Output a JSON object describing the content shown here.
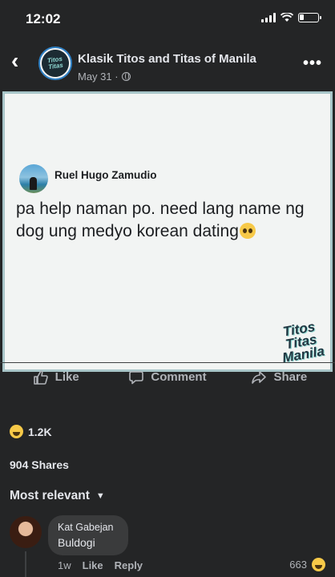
{
  "status_bar": {
    "time": "12:02",
    "battery_level": 0.25
  },
  "post": {
    "page_name": "Klasik Titos and Titas of Manila",
    "date": "May 31 ·",
    "page_logo_text": "Titos Titas",
    "image": {
      "author": "Ruel Hugo Zamudio",
      "text": "pa help naman po. need lang name ng dog ung medyo korean dating",
      "watermark": "Titos Titas Manila"
    }
  },
  "actions": {
    "like": "Like",
    "comment": "Comment",
    "share": "Share"
  },
  "stats": {
    "reactions_count": "1.2K",
    "shares": "904 Shares"
  },
  "comments_filter": "Most relevant",
  "comment": {
    "author": "Kat Gabejan",
    "text": "Buldogi",
    "time": "1w",
    "like": "Like",
    "reply": "Reply",
    "reaction_count": "663"
  },
  "colors": {
    "background": "#242526",
    "bubble": "#3a3b3c",
    "text_secondary": "#b0b3b8",
    "reaction": "#f7c948"
  },
  "icons": [
    "back-icon",
    "more-icon",
    "globe-icon",
    "like-icon",
    "comment-icon",
    "share-icon",
    "haha-icon",
    "pleading-face-icon",
    "chevron-down-icon"
  ]
}
